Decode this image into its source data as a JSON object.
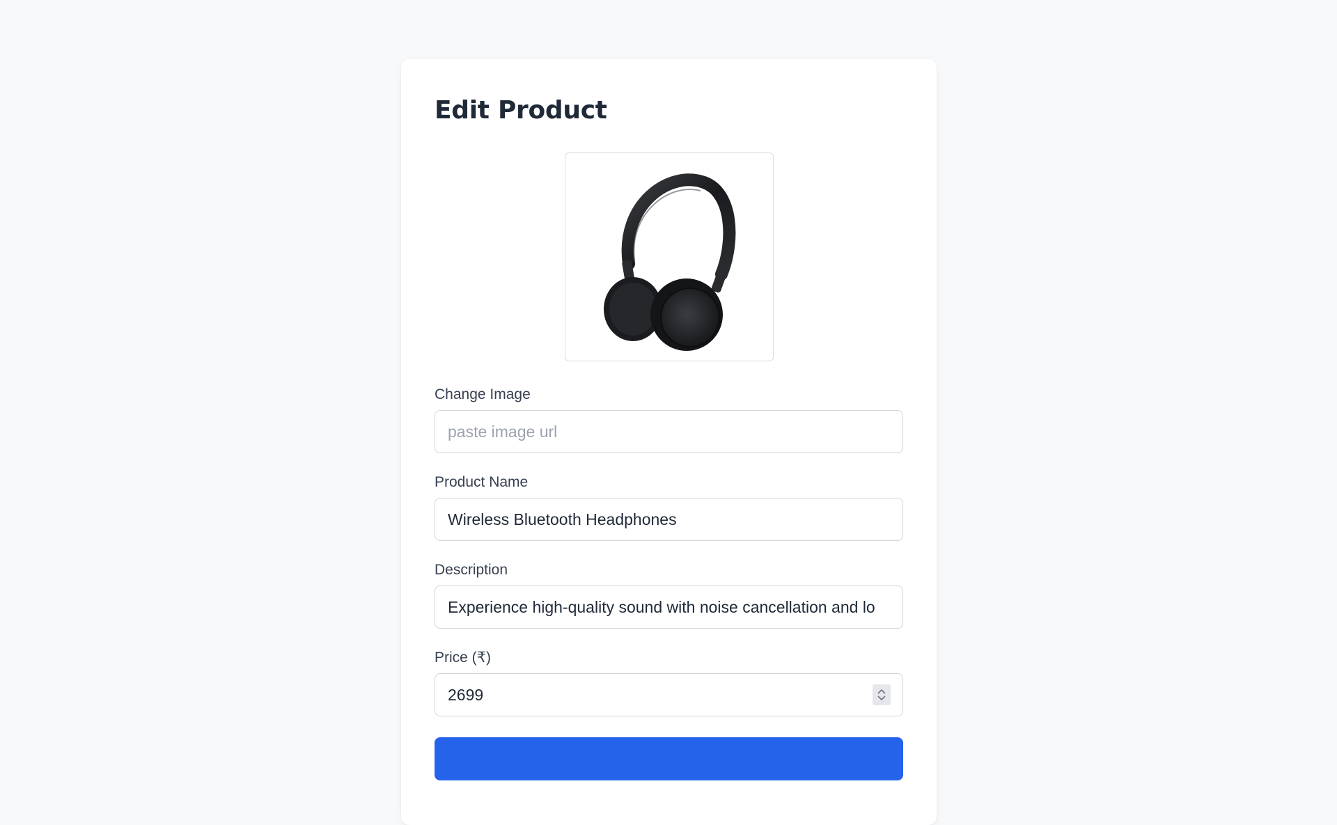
{
  "form": {
    "title": "Edit Product",
    "product_image": {
      "icon": "headphones-image"
    },
    "fields": {
      "image_url": {
        "label": "Change Image",
        "value": "",
        "placeholder": "paste image url"
      },
      "product_name": {
        "label": "Product Name",
        "value": "Wireless Bluetooth Headphones"
      },
      "description": {
        "label": "Description",
        "value": "Experience high-quality sound with noise cancellation and lo"
      },
      "price": {
        "label": "Price (₹)",
        "value": "2699"
      }
    },
    "submit_label": ""
  },
  "colors": {
    "background": "#f8f9fb",
    "card": "#ffffff",
    "primary_button": "#2563eb",
    "text": "#1f2937",
    "placeholder": "#9ca3af"
  }
}
